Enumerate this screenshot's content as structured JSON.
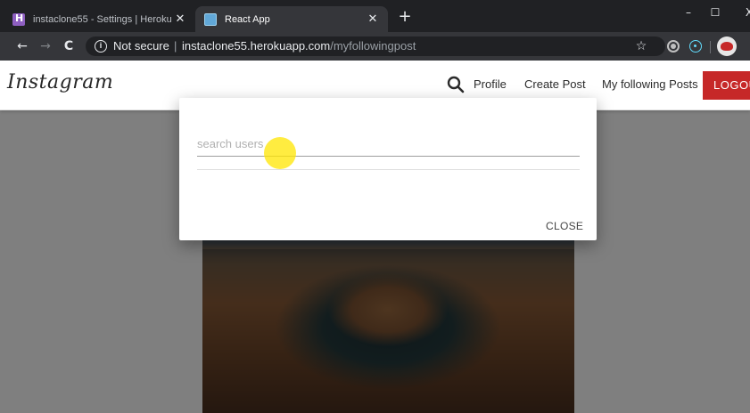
{
  "browser": {
    "tabs": [
      {
        "title": "instaclone55 - Settings | Heroku",
        "favicon": "heroku-icon",
        "active": false
      },
      {
        "title": "React App",
        "favicon": "react-icon",
        "active": true
      }
    ],
    "new_tab_symbol": "+",
    "window_controls": {
      "minimize": "–",
      "maximize": "☐",
      "close": "X"
    },
    "nav": {
      "back": "←",
      "forward": "→",
      "reload": "C"
    },
    "address_bar": {
      "security_text": "Not secure",
      "separator": "|",
      "host": "instaclone55.herokuapp.com",
      "path": "/myfollowingpost"
    },
    "bookmark_symbol": "☆"
  },
  "page": {
    "brand": "Instagram",
    "nav_links": {
      "profile": "Profile",
      "create_post": "Create Post",
      "following": "My following Posts",
      "logout": "LOGOUT"
    },
    "colors": {
      "logout_bg": "#c62828",
      "overlay": "rgba(0,0,0,0.5)"
    }
  },
  "modal": {
    "search_placeholder": "search users",
    "search_value": "",
    "close_label": "CLOSE"
  }
}
